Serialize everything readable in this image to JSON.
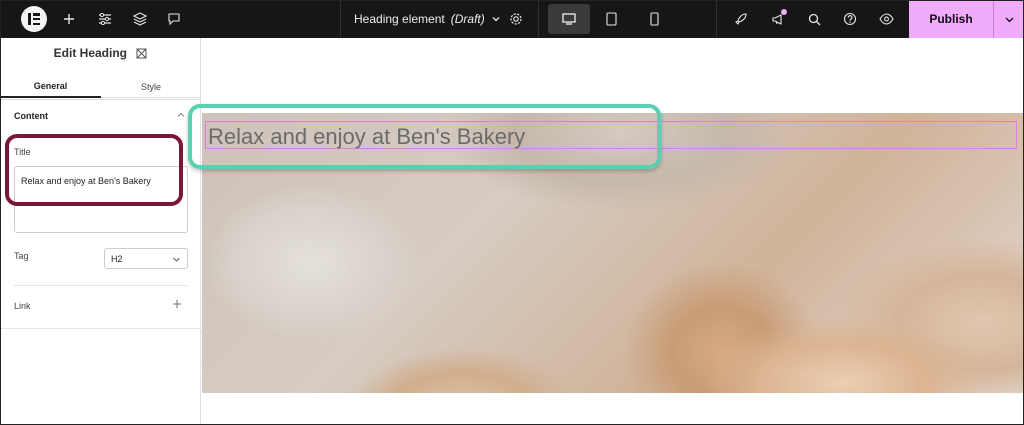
{
  "topbar": {
    "document_name": "Heading element",
    "document_status": "(Draft)",
    "publish_label": "Publish"
  },
  "panel": {
    "title": "Edit Heading",
    "tabs": [
      {
        "label": "General"
      },
      {
        "label": "Style"
      }
    ],
    "section": "Content",
    "title_label": "Title",
    "title_value": "Relax and enjoy at Ben's Bakery",
    "tag_label": "Tag",
    "tag_value": "H2",
    "link_label": "Link"
  },
  "canvas": {
    "heading": "Relax and enjoy at Ben's Bakery"
  },
  "colors": {
    "publish_bg": "#f0abfc",
    "highlight_teal": "#5ad0b2",
    "highlight_maroon": "#7a1739",
    "selection_outline": "#e07ce0"
  }
}
